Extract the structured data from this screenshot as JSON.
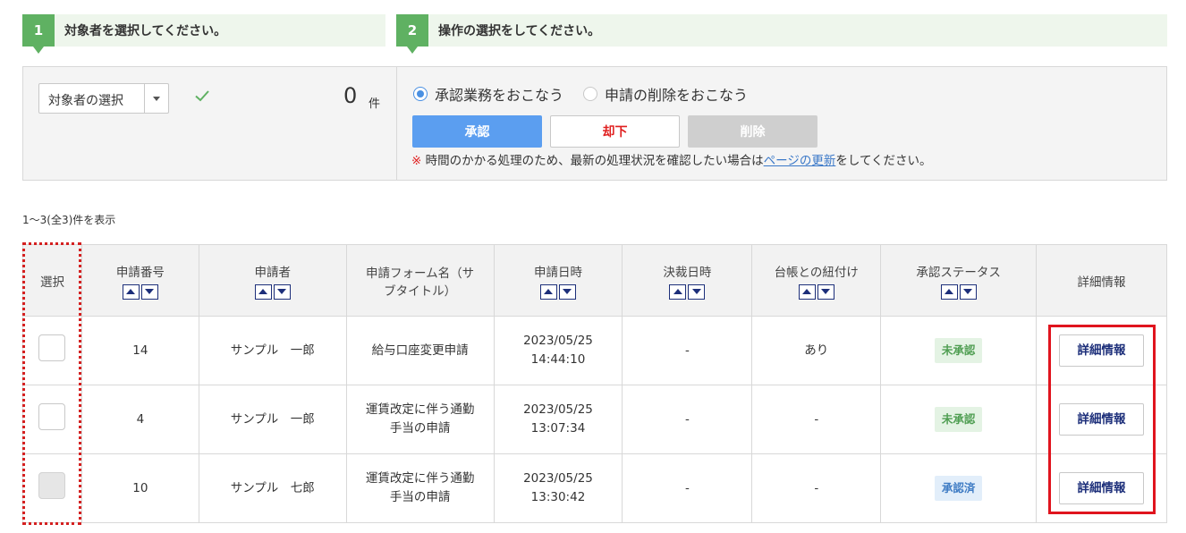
{
  "steps": [
    {
      "number": "1",
      "title": "対象者を選択してください。"
    },
    {
      "number": "2",
      "title": "操作の選択をしてください。"
    }
  ],
  "target": {
    "select_label": "対象者の選択",
    "count": "0",
    "count_unit": "件"
  },
  "operation": {
    "options": [
      {
        "label": "承認業務をおこなう",
        "selected": true
      },
      {
        "label": "申請の削除をおこなう",
        "selected": false
      }
    ],
    "buttons": {
      "approve": "承認",
      "reject": "却下",
      "delete": "削除"
    },
    "note": {
      "mark": "※",
      "text_before": "時間のかかる処理のため、最新の処理状況を確認したい場合は",
      "link": "ページの更新",
      "text_after": "をしてください。"
    }
  },
  "summary": "1〜3(全3)件を表示",
  "table": {
    "headers": [
      {
        "label": "選択",
        "sortable": false
      },
      {
        "label": "申請番号",
        "sortable": true
      },
      {
        "label": "申請者",
        "sortable": true
      },
      {
        "label": "申請フォーム名（サ\nブタイトル）",
        "sortable": false
      },
      {
        "label": "申請日時",
        "sortable": true
      },
      {
        "label": "決裁日時",
        "sortable": true
      },
      {
        "label": "台帳との紐付け",
        "sortable": true
      },
      {
        "label": "承認ステータス",
        "sortable": true
      },
      {
        "label": "詳細情報",
        "sortable": false
      }
    ],
    "rows": [
      {
        "id": "14",
        "applicant": "サンプル　一郎",
        "form_line1": "給与口座変更申請",
        "form_line2": "",
        "date_line1": "2023/05/25",
        "date_line2": "14:44:10",
        "decision": "-",
        "ledger": "あり",
        "status": "未承認",
        "detail": "詳細情報",
        "checkbox_disabled": false
      },
      {
        "id": "4",
        "applicant": "サンプル　一郎",
        "form_line1": "運賃改定に伴う通勤",
        "form_line2": "手当の申請",
        "date_line1": "2023/05/25",
        "date_line2": "13:07:34",
        "decision": "-",
        "ledger": "-",
        "status": "未承認",
        "detail": "詳細情報",
        "checkbox_disabled": false
      },
      {
        "id": "10",
        "applicant": "サンプル　七郎",
        "form_line1": "運賃改定に伴う通勤",
        "form_line2": "手当の申請",
        "date_line1": "2023/05/25",
        "date_line2": "13:30:42",
        "decision": "-",
        "ledger": "-",
        "status": "承認済",
        "detail": "詳細情報",
        "checkbox_disabled": true
      }
    ]
  },
  "colors": {
    "step_green": "#5fb162",
    "approve_blue": "#5b9ef0",
    "reject_red": "#e02020",
    "highlight_red": "#e0141e",
    "sort_navy": "#1d2f7a"
  }
}
